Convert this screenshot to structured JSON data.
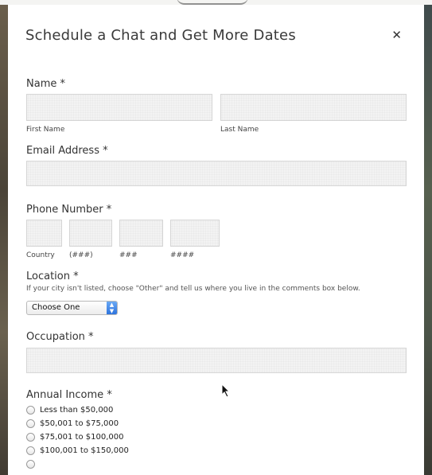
{
  "modal": {
    "title": "Schedule a Chat and Get More Dates",
    "close_symbol": "✕"
  },
  "form": {
    "name": {
      "label": "Name",
      "required_mark": "*",
      "first_label": "First Name",
      "last_label": "Last Name"
    },
    "email": {
      "label": "Email Address",
      "required_mark": "*"
    },
    "phone": {
      "label": "Phone Number",
      "required_mark": "*",
      "parts": [
        "Country",
        "(###)",
        "###",
        "####"
      ]
    },
    "location": {
      "label": "Location",
      "required_mark": "*",
      "help": "If your city isn't listed, choose \"Other\" and tell us where you live in the comments box below.",
      "selected": "Choose One"
    },
    "occupation": {
      "label": "Occupation",
      "required_mark": "*"
    },
    "income": {
      "label": "Annual Income",
      "required_mark": "*",
      "options": [
        "Less than $50,000",
        "$50,001 to $75,000",
        "$75,001 to $100,000",
        "$100,001 to $150,000"
      ]
    }
  }
}
